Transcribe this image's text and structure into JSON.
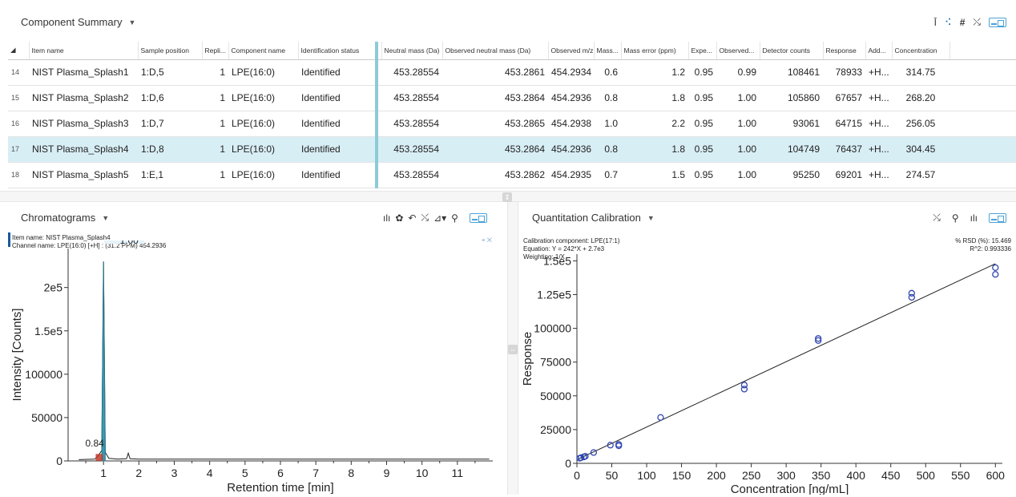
{
  "summary": {
    "title": "Component Summary",
    "icons": [
      "filter-icon",
      "network-icon",
      "hash-icon",
      "fit-icon"
    ],
    "columns": [
      "Item name",
      "Sample position",
      "Repli...",
      "Component name",
      "Identification status",
      "Neutral mass (Da)",
      "Observed neutral mass (Da)",
      "Observed m/z",
      "Mass...",
      "Mass error (ppm)",
      "Expe...",
      "Observed...",
      "Detector counts",
      "Response",
      "Add...",
      "Concentration"
    ],
    "rows": [
      {
        "n": "14",
        "cells": [
          "NIST Plasma_Splash1",
          "1:D,5",
          "1",
          "LPE(16:0)",
          "Identified",
          "453.28554",
          "453.2861",
          "454.2934",
          "0.6",
          "1.2",
          "0.95",
          "0.99",
          "108461",
          "78933",
          "+H...",
          "314.75"
        ]
      },
      {
        "n": "15",
        "cells": [
          "NIST Plasma_Splash2",
          "1:D,6",
          "1",
          "LPE(16:0)",
          "Identified",
          "453.28554",
          "453.2864",
          "454.2936",
          "0.8",
          "1.8",
          "0.95",
          "1.00",
          "105860",
          "67657",
          "+H...",
          "268.20"
        ]
      },
      {
        "n": "16",
        "cells": [
          "NIST Plasma_Splash3",
          "1:D,7",
          "1",
          "LPE(16:0)",
          "Identified",
          "453.28554",
          "453.2865",
          "454.2938",
          "1.0",
          "2.2",
          "0.95",
          "1.00",
          "93061",
          "64715",
          "+H...",
          "256.05"
        ]
      },
      {
        "n": "17",
        "cells": [
          "NIST Plasma_Splash4",
          "1:D,8",
          "1",
          "LPE(16:0)",
          "Identified",
          "453.28554",
          "453.2864",
          "454.2936",
          "0.8",
          "1.8",
          "0.95",
          "1.00",
          "104749",
          "76437",
          "+H...",
          "304.45"
        ],
        "selected": true
      },
      {
        "n": "18",
        "cells": [
          "NIST Plasma_Splash5",
          "1:E,1",
          "1",
          "LPE(16:0)",
          "Identified",
          "453.28554",
          "453.2862",
          "454.2935",
          "0.7",
          "1.5",
          "0.95",
          "1.00",
          "95250",
          "69201",
          "+H...",
          "274.57"
        ]
      }
    ]
  },
  "chrom": {
    "title": "Chromatograms",
    "info1": "Item name: NIST Plasma_Splash4",
    "info2": "Channel name: LPE(16:0) [+H] : (31.2 PPM) 454.2936",
    "pin": "⌖ ✕"
  },
  "calib": {
    "title": "Quantitation Calibration",
    "info1": "Calibration component: LPE(17:1)",
    "info2": "Equation: Y = 242*X + 2.7e3",
    "info3": "Weighting: 1/X",
    "rsd": "% RSD (%): 15.469",
    "r2": "R^2: 0.993336"
  },
  "chart_data": [
    {
      "type": "line",
      "xlabel": "Retention time [min]",
      "ylabel": "Intensity [Counts]",
      "xlim": [
        0,
        12
      ],
      "ylim": [
        0,
        245000
      ],
      "xticks": [
        "1",
        "2",
        "3",
        "4",
        "5",
        "6",
        "7",
        "8",
        "9",
        "10",
        "11"
      ],
      "yticks": [
        "0",
        "50000",
        "100000",
        "1.5e5",
        "2e5"
      ],
      "peak_label": "LPE(16:0)",
      "peak_value": "1.00",
      "minor_label": "0.84",
      "series": [
        {
          "x": [
            0.3,
            0.75,
            0.85,
            0.95,
            1.0,
            1.05,
            1.15,
            1.4,
            1.65,
            1.7,
            1.75,
            2.0,
            11.9
          ],
          "y": [
            1500,
            2000,
            6000,
            12000,
            230000,
            10000,
            3000,
            2000,
            2500,
            9000,
            2500,
            2000,
            2000
          ]
        }
      ]
    },
    {
      "type": "scatter",
      "xlabel": "Concentration [ng/mL]",
      "ylabel": "Response",
      "xlim": [
        0,
        610
      ],
      "ylim": [
        0,
        155000
      ],
      "xticks": [
        "0",
        "50",
        "100",
        "150",
        "200",
        "250",
        "300",
        "350",
        "400",
        "450",
        "500",
        "550",
        "600"
      ],
      "yticks": [
        "0",
        "25000",
        "50000",
        "75000",
        "100000",
        "1.25e5",
        "1.5e5"
      ],
      "points": [
        [
          4,
          3800
        ],
        [
          6,
          4200
        ],
        [
          10,
          4800
        ],
        [
          12,
          5200
        ],
        [
          24,
          8000
        ],
        [
          48,
          13500
        ],
        [
          60,
          13000
        ],
        [
          60,
          14000
        ],
        [
          120,
          34000
        ],
        [
          240,
          55000
        ],
        [
          240,
          58000
        ],
        [
          346,
          91000
        ],
        [
          346,
          92500
        ],
        [
          480,
          123000
        ],
        [
          480,
          126000
        ],
        [
          600,
          140000
        ],
        [
          600,
          145000
        ]
      ],
      "fit": {
        "slope": 242,
        "intercept": 2700
      }
    }
  ]
}
